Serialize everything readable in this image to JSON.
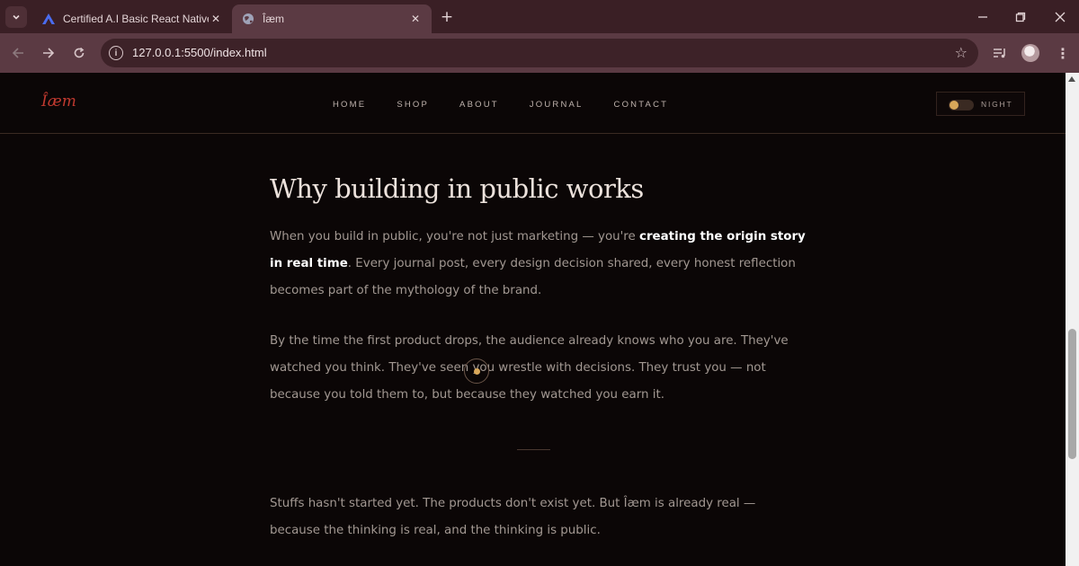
{
  "browser": {
    "tabs": [
      {
        "title": "Certified A.I Basic React Native",
        "favicon": "triangle-logo-icon",
        "active": false
      },
      {
        "title": "Îæm",
        "favicon": "globe-icon",
        "active": true
      }
    ],
    "url": "127.0.0.1:5500/index.html"
  },
  "site": {
    "logo": "Îæm",
    "nav": [
      "HOME",
      "SHOP",
      "ABOUT",
      "JOURNAL",
      "CONTACT"
    ],
    "toggle_label": "NIGHT"
  },
  "article": {
    "heading": "Why building in public works",
    "p1_a": "When you build in public, you're not just marketing — you're ",
    "p1_strong": "creating the origin story in real time",
    "p1_b": ". Every journal post, every design decision shared, every honest reflection becomes part of the mythology of the brand.",
    "p2": "By the time the first product drops, the audience already knows who you are. They've watched you think. They've seen you wrestle with decisions. They trust you — not because you told them to, but because they watched you earn it.",
    "p3": "Stuffs hasn't started yet. The products don't exist yet. But Îæm is already real — because the thinking is real, and the thinking is public."
  },
  "colors": {
    "accent": "#c0392f",
    "gold": "#d9a85a",
    "background": "#0b0606"
  }
}
